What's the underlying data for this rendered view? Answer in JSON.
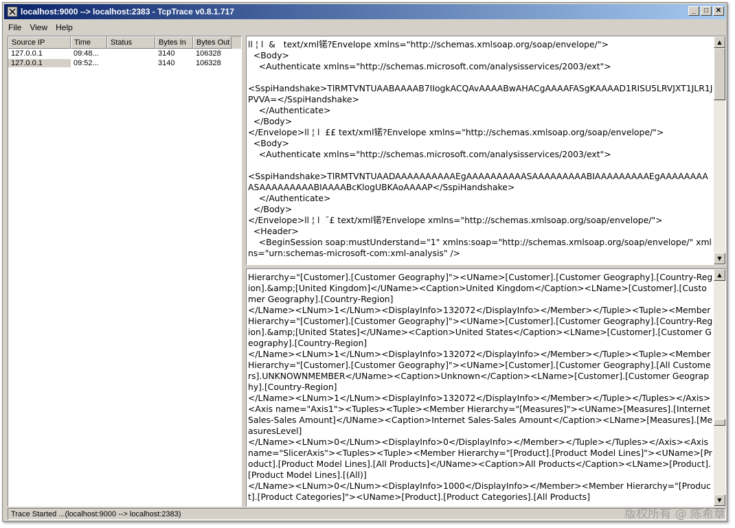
{
  "window": {
    "title": "localhost:9000 --> localhost:2383 - TcpTrace v0.8.1.717",
    "minimize": "_",
    "maximize": "□",
    "close": "✕"
  },
  "menu": {
    "items": [
      "File",
      "View",
      "Help"
    ]
  },
  "connections": {
    "headers": [
      "Source IP",
      "Time",
      "Status",
      "Bytes In",
      "Bytes Out"
    ],
    "rows": [
      {
        "source_ip": "127.0.0.1",
        "time": "09:48...",
        "status": "",
        "bytes_in": "3140",
        "bytes_out": "106328"
      },
      {
        "source_ip": "127.0.0.1",
        "time": "09:52...",
        "status": "",
        "bytes_in": "3140",
        "bytes_out": "106328"
      }
    ]
  },
  "request_pane": {
    "text": "ll ¦ l  &   text/xml锘?Envelope xmlns=\"http://schemas.xmlsoap.org/soap/envelope/\">\n  <Body>\n    <Authenticate xmlns=\"http://schemas.microsoft.com/analysisservices/2003/ext\">\n\n<SspiHandshake>TlRMTVNTUAABAAAAB7IIogkACQAvAAAABwAHACgAAAAFASgKAAAAD1RISU5LRVJXT1JLR1JPVVA=</SspiHandshake>\n    </Authenticate>\n  </Body>\n</Envelope>ll ¦ l  ££ text/xml锘?Envelope xmlns=\"http://schemas.xmlsoap.org/soap/envelope/\">\n  <Body>\n    <Authenticate xmlns=\"http://schemas.microsoft.com/analysisservices/2003/ext\">\n\n<SspiHandshake>TlRMTVNTUAADAAAAAAAAAAEgAAAAAAAAAASAAAAAAAAABIAAAAAAAAAEgAAAAAAAAASAAAAAAAAABIAAAABcKlogUBKAoAAAAP</SspiHandshake>\n    </Authenticate>\n  </Body>\n</Envelope>ll ¦ l  ¯£ text/xml锘?Envelope xmlns=\"http://schemas.xmlsoap.org/soap/envelope/\">\n  <Header>\n    <BeginSession soap:mustUnderstand=\"1\" xmlns:soap=\"http://schemas.xmlsoap.org/soap/envelope/\" xmlns=\"urn:schemas-microsoft-com:xml-analysis\" />"
  },
  "response_pane": {
    "text": "Hierarchy=\"[Customer].[Customer Geography]\"><UName>[Customer].[Customer Geography].[Country-Region].&amp;[United Kingdom]</UName><Caption>United Kingdom</Caption><LName>[Customer].[Customer Geography].[Country-Region]\n</LName><LNum>1</LNum><DisplayInfo>132072</DisplayInfo></Member></Tuple><Tuple><Member Hierarchy=\"[Customer].[Customer Geography]\"><UName>[Customer].[Customer Geography].[Country-Region].&amp;[United States]</UName><Caption>United States</Caption><LName>[Customer].[Customer Geography].[Country-Region]\n</LName><LNum>1</LNum><DisplayInfo>132072</DisplayInfo></Member></Tuple><Tuple><Member Hierarchy=\"[Customer].[Customer Geography]\"><UName>[Customer].[Customer Geography].[All Customers].UNKNOWNMEMBER</UName><Caption>Unknown</Caption><LName>[Customer].[Customer Geography].[Country-Region]\n</LName><LNum>1</LNum><DisplayInfo>132072</DisplayInfo></Member></Tuple></Tuples></Axis><Axis name=\"Axis1\"><Tuples><Tuple><Member Hierarchy=\"[Measures]\"><UName>[Measures].[Internet Sales-Sales Amount]</UName><Caption>Internet Sales-Sales Amount</Caption><LName>[Measures].[MeasuresLevel]\n</LName><LNum>0</LNum><DisplayInfo>0</DisplayInfo></Member></Tuple></Tuples></Axis><Axis name=\"SlicerAxis\"><Tuples><Tuple><Member Hierarchy=\"[Product].[Product Model Lines]\"><UName>[Product].[Product Model Lines].[All Products]</UName><Caption>All Products</Caption><LName>[Product].[Product Model Lines].[(All)]\n</LName><LNum>0</LNum><DisplayInfo>1000</DisplayInfo></Member><Member Hierarchy=\"[Product].[Product Categories]\"><UName>[Product].[Product Categories].[All Products]"
  },
  "status": {
    "text": "Trace Started ...(localhost:9000 --> localhost:2383)"
  },
  "watermark": {
    "text": "版权所有 @ 陈希章"
  }
}
